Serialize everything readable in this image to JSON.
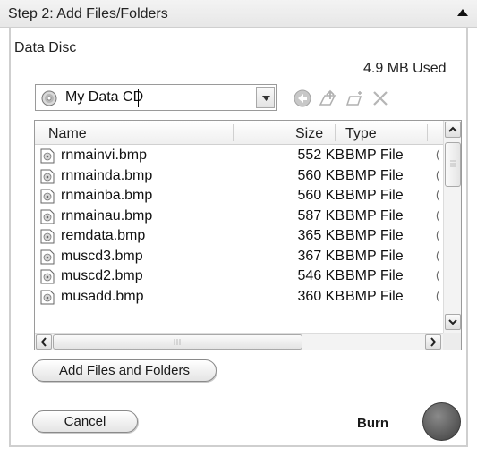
{
  "header": {
    "title": "Step 2: Add Files/Folders",
    "collapse_icon": "triangle-up-icon"
  },
  "disc": {
    "label": "Data Disc",
    "usage": "4.9 MB Used",
    "location": "My Data CD"
  },
  "toolbar": {
    "icons": [
      "back-arrow-icon",
      "up-folder-icon",
      "new-folder-icon",
      "delete-icon"
    ]
  },
  "file_list": {
    "columns": [
      "Name",
      "Size",
      "Type"
    ],
    "rows": [
      {
        "name": "rnmainvi.bmp",
        "size": "552 KB",
        "type": "BMP File",
        "extra": "("
      },
      {
        "name": "rnmainda.bmp",
        "size": "560 KB",
        "type": "BMP File",
        "extra": "("
      },
      {
        "name": "rnmainba.bmp",
        "size": "560 KB",
        "type": "BMP File",
        "extra": "("
      },
      {
        "name": "rnmainau.bmp",
        "size": "587 KB",
        "type": "BMP File",
        "extra": "("
      },
      {
        "name": "remdata.bmp",
        "size": "365 KB",
        "type": "BMP File",
        "extra": "("
      },
      {
        "name": "muscd3.bmp",
        "size": "367 KB",
        "type": "BMP File",
        "extra": "("
      },
      {
        "name": "muscd2.bmp",
        "size": "546 KB",
        "type": "BMP File",
        "extra": "("
      },
      {
        "name": "musadd.bmp",
        "size": "360 KB",
        "type": "BMP File",
        "extra": "("
      }
    ]
  },
  "buttons": {
    "add_files": "Add Files and Folders",
    "cancel": "Cancel",
    "burn": "Burn"
  },
  "colors": {
    "burn_button": "#6e6e6e",
    "header_bg": "#eeeeee"
  }
}
